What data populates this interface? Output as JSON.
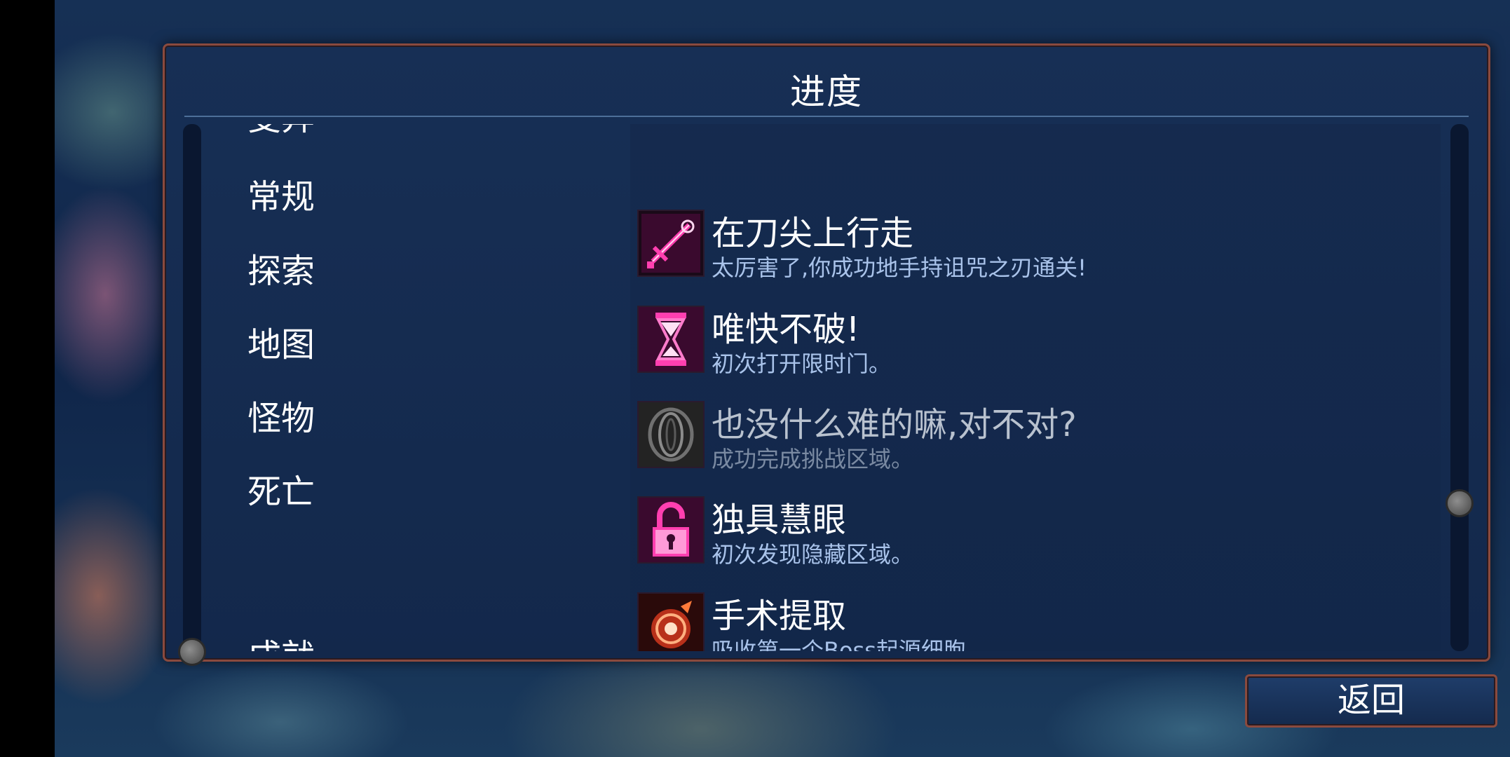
{
  "panel": {
    "title": "进度"
  },
  "categories": [
    {
      "label": "变异"
    },
    {
      "label": "常规"
    },
    {
      "label": "探索"
    },
    {
      "label": "地图"
    },
    {
      "label": "怪物"
    },
    {
      "label": "死亡"
    },
    {
      "label": "成就",
      "selected": true
    }
  ],
  "achievements": [
    {
      "title": "在刀尖上行走",
      "desc": "太厉害了,你成功地手持诅咒之刃通关!",
      "icon": "sword-icon",
      "unlocked": true
    },
    {
      "title": "唯快不破!",
      "desc": "初次打开限时门。",
      "icon": "hourglass-icon",
      "unlocked": true
    },
    {
      "title": "也没什么难的嘛,对不对?",
      "desc": "成功完成挑战区域。",
      "icon": "challenge-rune-icon",
      "unlocked": false
    },
    {
      "title": "独具慧眼",
      "desc": "初次发现隐藏区域。",
      "icon": "unlocked-padlock-icon",
      "unlocked": true
    },
    {
      "title": "手术提取",
      "desc": "吸收第一个Boss起源细胞。",
      "icon": "boss-cell-icon",
      "unlocked": true
    }
  ],
  "back_button": {
    "label": "返回"
  },
  "colors": {
    "accent_magenta": "#e0208c",
    "accent_orange": "#e0552a",
    "frame_border": "#8a4a3e",
    "selected_bar": "#4fb8f0",
    "description_text": "#a9c3ea"
  }
}
